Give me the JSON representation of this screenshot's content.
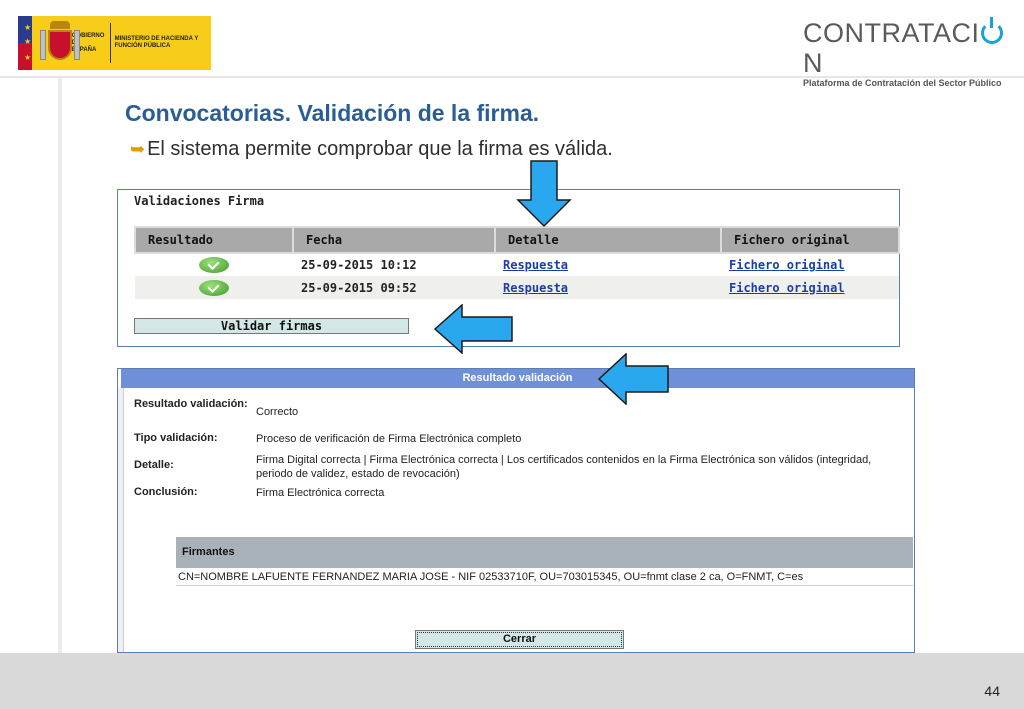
{
  "header": {
    "gov_logo": {
      "line1": "GOBIERNO DE ESPAÑA",
      "line2": "MINISTERIO DE HACIENDA Y FUNCIÓN PÚBLICA"
    },
    "brand": {
      "word_before": "CONTRATACI",
      "word_after": "N",
      "subtitle": "Plataforma de Contratación del Sector Público",
      "accent": "#1aa1d8"
    }
  },
  "slide": {
    "title": "Convocatorias. Validación de la firma.",
    "bullet": "El sistema permite comprobar que la firma es válida.",
    "title_color": "#2a5d95"
  },
  "validaciones": {
    "heading": "Validaciones Firma",
    "columns": [
      "Resultado",
      "Fecha",
      "Detalle",
      "Fichero original"
    ],
    "rows": [
      {
        "resultado_icon": "check-icon",
        "fecha": "25-09-2015 10:12",
        "detalle": "Respuesta",
        "fichero": "Fichero original"
      },
      {
        "resultado_icon": "check-icon",
        "fecha": "25-09-2015 09:52",
        "detalle": "Respuesta",
        "fichero": "Fichero original"
      }
    ],
    "button": "Validar firmas"
  },
  "resultado": {
    "bar_title": "Resultado validación",
    "fields": [
      {
        "label": "Resultado validación:",
        "value": "Correcto"
      },
      {
        "label": "Tipo validación:",
        "value": "Proceso de verificación de Firma Electrónica completo"
      },
      {
        "label": "Detalle:",
        "value": "Firma Digital correcta | Firma Electrónica correcta | Los certificados contenidos en la Firma Electrónica son válidos (integridad, periodo de validez, estado de revocación)"
      },
      {
        "label": "Conclusión:",
        "value": "Firma Electrónica correcta"
      }
    ],
    "firmantes_heading": "Firmantes",
    "firmante": "CN=NOMBRE LAFUENTE FERNANDEZ MARIA JOSE - NIF 02533710F, OU=703015345, OU=fnmt clase 2 ca, O=FNMT, C=es",
    "close_button": "Cerrar"
  },
  "footer": {
    "page_number": "44"
  },
  "colors": {
    "arrow_fill": "#29a8f0",
    "panel_bar": "#6f8fd8",
    "table_header": "#a9a9a9"
  }
}
